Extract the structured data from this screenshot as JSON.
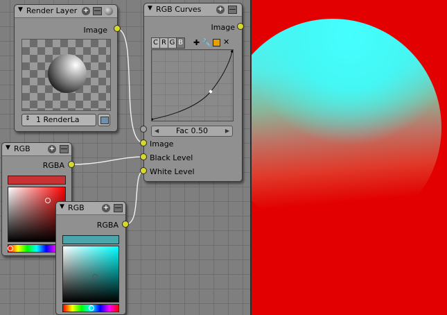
{
  "render_layer_node": {
    "title": "Render Layer",
    "output_label": "Image",
    "layer_select": "1 RenderLa"
  },
  "rgb_curves_node": {
    "title": "RGB Curves",
    "output_label": "Image",
    "channel_tabs": [
      "C",
      "R",
      "G",
      "B"
    ],
    "selected_channel": "B",
    "fac_field": "Fac 0.50",
    "inputs": [
      "Image",
      "Black Level",
      "White Level"
    ]
  },
  "rgb_node_1": {
    "title": "RGB",
    "output_label": "RGBA",
    "color": "#c83232"
  },
  "rgb_node_2": {
    "title": "RGB",
    "output_label": "RGBA",
    "color": "#4aa6ab"
  },
  "colors": {
    "editor_bg": "#7f7f7f",
    "node_header": "#a9a9a9",
    "socket": "#d7d82c",
    "viewer_bg": "#e20000",
    "sphere_highlight": "#44ffff"
  },
  "icons": [
    "collapse-triangle-icon",
    "add-icon",
    "minmax-icon",
    "preview-ball-icon",
    "image-icon",
    "up-down-icon",
    "zoom-in-icon",
    "zoom-out-icon",
    "clip-icon",
    "delete-icon"
  ]
}
